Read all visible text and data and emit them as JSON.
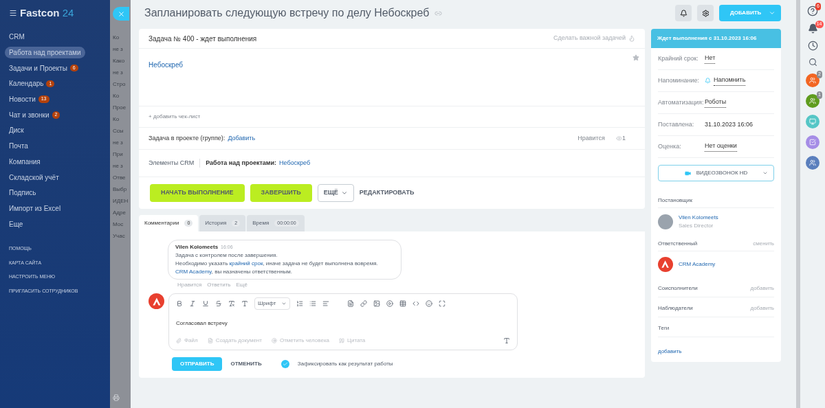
{
  "sidebar": {
    "logo": {
      "name": "Fastcon",
      "number": "24"
    },
    "items": [
      {
        "label": "CRM",
        "selected": false
      },
      {
        "label": "Работа над проектами",
        "selected": true
      },
      {
        "label": "Задачи и Проекты",
        "selected": false,
        "badge": "6"
      },
      {
        "label": "Календарь",
        "selected": false,
        "badge": "1"
      },
      {
        "label": "Новости",
        "selected": false,
        "badge": "13"
      },
      {
        "label": "Чат и звонки",
        "selected": false,
        "badge": "2"
      },
      {
        "label": "Диск",
        "selected": false
      },
      {
        "label": "Почта",
        "selected": false
      },
      {
        "label": "Компания",
        "selected": false
      },
      {
        "label": "Складской учёт",
        "selected": false
      },
      {
        "label": "Подпись",
        "selected": false
      },
      {
        "label": "Импорт из Excel",
        "selected": false
      },
      {
        "label": "Еще",
        "selected": false
      }
    ],
    "links": [
      "ПОМОЩЬ",
      "КАРТА САЙТА",
      "НАСТРОИТЬ МЕНЮ",
      "ПРИГЛАСИТЬ СОТРУДНИКОВ"
    ]
  },
  "background_fragments": [
    "Ко",
    "не з",
    "Како",
    "не з",
    "Стро",
    "Ко",
    "Прое",
    "Ко",
    "Ссы",
    "не з",
    "При",
    "не з",
    "Отве",
    "Выбр",
    "ИДЕН",
    "Адре",
    "Мос",
    "Учас"
  ],
  "task": {
    "title": "Запланировать следующую встречу по делу Небоскреб",
    "add_button": "ДОБАВИТЬ",
    "header": "Задача № 400 - ждет выполнения",
    "important_link": "Сделать важной задачей",
    "description": "Небоскреб",
    "checklist_link": "+ добавить чек-лист",
    "project_label": "Задача в проекте (группе):",
    "project_link": "Добавить",
    "like": "Нравится",
    "views": "1",
    "crm_label": "Элементы CRM",
    "crm_entity": "Работа над проектами:",
    "crm_link": "Небоскреб",
    "actions": [
      {
        "label": "НАЧАТЬ ВЫПОЛНЕНИЕ",
        "kind": "primary"
      },
      {
        "label": "ЗАВЕРШИТЬ",
        "kind": "primary"
      },
      {
        "label": "ЕЩЁ",
        "kind": "dropdown"
      },
      {
        "label": "РЕДАКТИРОВАТЬ",
        "kind": "link"
      }
    ]
  },
  "tabs": [
    {
      "label": "Комментарии",
      "count": "0",
      "selected": true
    },
    {
      "label": "История",
      "count": "2",
      "selected": false
    },
    {
      "label": "Время",
      "count": "00:00:00",
      "selected": false
    }
  ],
  "comment": {
    "author": "Vilen Kolomeets",
    "time": "16:06",
    "lines": [
      {
        "text": "Задача с контролем после завершения."
      },
      {
        "text": "Необходимо указать",
        "link": "крайний срок",
        "after": ", иначе задача не будет выполнена вовремя."
      },
      {
        "link": "CRM Academy",
        "after": ", вы назначены ответственным."
      }
    ],
    "actions": [
      "Нравится",
      "Ответить",
      "Ещё"
    ]
  },
  "editor": {
    "font_select": "Шрифт",
    "value": "Согласовал встречу",
    "attachments": [
      "Файл",
      "Создать документ",
      "Отметить человека",
      "Цитата"
    ],
    "send": "ОТПРАВИТЬ",
    "cancel": "ОТМЕНИТЬ",
    "result_checkbox": {
      "label": "Зафиксировать как результат работы",
      "checked": true
    }
  },
  "details": {
    "status": "Ждет выполнения с 31.10.2023 16:06",
    "fields": [
      {
        "label": "Крайний срок:",
        "value": "Нет",
        "kind": "dotted"
      },
      {
        "label": "Напоминание:",
        "value": "Напомнить",
        "kind": "bell"
      },
      {
        "label": "Автоматизация:",
        "value": "Роботы",
        "kind": "dotted"
      },
      {
        "label": "Поставлена:",
        "value": "31.10.2023 16:06",
        "kind": "plain"
      },
      {
        "label": "Оценка:",
        "value": "Нет оценки",
        "kind": "dotted"
      }
    ],
    "video_button": "ВИДЕОЗВОНОК HD",
    "creator": {
      "heading": "Постановщик",
      "name": "Vilen Kolomeets",
      "role": "Sales Director"
    },
    "responsible": {
      "heading": "Ответственный",
      "action": "сменить",
      "name": "CRM Academy"
    },
    "sections": [
      {
        "heading": "Соисполнители",
        "action": "добавить"
      },
      {
        "heading": "Наблюдатели",
        "action": "добавить"
      }
    ],
    "tags": {
      "heading": "Теги",
      "link": "добавить"
    }
  },
  "rightbar": {
    "help_badge": "6",
    "bell_badge": "14",
    "group_badges": [
      "2",
      "1"
    ]
  }
}
